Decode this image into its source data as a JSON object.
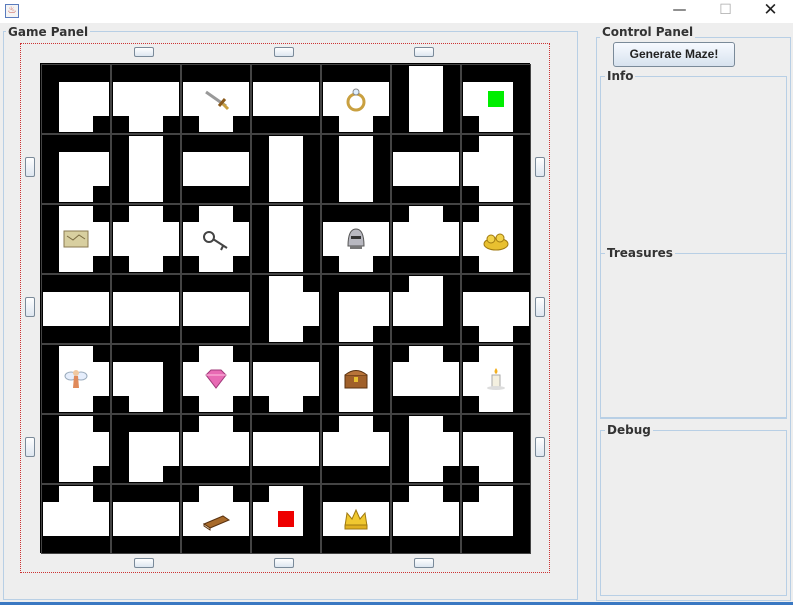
{
  "window": {
    "minimize": "—",
    "maximize": "☐",
    "close": "✕"
  },
  "game_panel": {
    "legend": "Game Panel"
  },
  "control_panel": {
    "legend": "Control Panel",
    "generate_button": "Generate Maze!",
    "info_legend": "Info",
    "treasures_legend": "Treasures",
    "debug_legend": "Debug"
  },
  "maze": {
    "rows": 7,
    "cols": 7,
    "tile_openings": [
      [
        "RD",
        "LRD",
        "LRD",
        "LR",
        "LRD",
        "UD",
        "LD"
      ],
      [
        "RD",
        "UD",
        "LR",
        "UD",
        "UD",
        "LR",
        "ULD"
      ],
      [
        "URD",
        "ULRD",
        "ULRD",
        "UD",
        "LRD",
        "URL",
        "ULD"
      ],
      [
        "LR",
        "LR",
        "LR",
        "URD",
        "RD",
        "UL",
        "LRD"
      ],
      [
        "URD",
        "LD",
        "ULRD",
        "LRD",
        "UD",
        "ULR",
        "ULD"
      ],
      [
        "URD",
        "RD",
        "URL",
        "LR",
        "ULR",
        "URD",
        "LD"
      ],
      [
        "URL",
        "LR",
        "URL",
        "UL",
        "LR",
        "ULR",
        "UL"
      ]
    ],
    "treasures": [
      {
        "row": 0,
        "col": 2,
        "name": "sword-icon"
      },
      {
        "row": 0,
        "col": 4,
        "name": "ring-icon"
      },
      {
        "row": 2,
        "col": 0,
        "name": "map-icon"
      },
      {
        "row": 2,
        "col": 2,
        "name": "keys-icon"
      },
      {
        "row": 2,
        "col": 4,
        "name": "helmet-icon"
      },
      {
        "row": 2,
        "col": 6,
        "name": "gold-icon"
      },
      {
        "row": 4,
        "col": 0,
        "name": "fairy-icon"
      },
      {
        "row": 4,
        "col": 2,
        "name": "gem-icon"
      },
      {
        "row": 4,
        "col": 4,
        "name": "chest-icon"
      },
      {
        "row": 4,
        "col": 6,
        "name": "candle-icon"
      },
      {
        "row": 6,
        "col": 2,
        "name": "book-icon"
      },
      {
        "row": 6,
        "col": 4,
        "name": "crown-icon"
      }
    ],
    "players": [
      {
        "row": 0,
        "col": 6,
        "color": "#00ee00",
        "name": "green-player"
      },
      {
        "row": 6,
        "col": 3,
        "color": "#ee0000",
        "name": "red-player"
      }
    ]
  }
}
